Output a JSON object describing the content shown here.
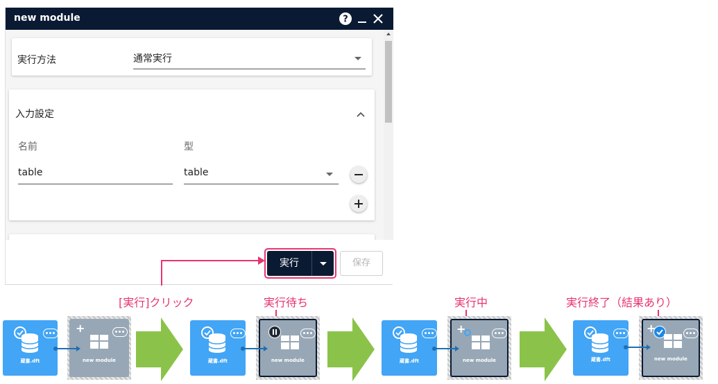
{
  "dialog": {
    "title": "new module",
    "exec_method_label": "実行方法",
    "exec_method_value": "通常実行",
    "input_section_title": "入力設定",
    "col_name_label": "名前",
    "col_type_label": "型",
    "row_name_value": "table",
    "row_type_value": "table",
    "run_button_label": "実行",
    "save_button_label": "保存"
  },
  "annotations": {
    "click_run": "[実行]クリック",
    "waiting": "実行待ち",
    "running": "実行中",
    "finished": "実行終了（結果あり）"
  },
  "flow": {
    "source_node_caption": "蔵書.dft",
    "module_node_caption": "new module"
  },
  "colors": {
    "titlebar": "#0b1a33",
    "accent_pink": "#e8336e",
    "node_blue": "#42a5f5",
    "node_gray": "#97a7b6",
    "arrow_green": "#8bc34a"
  }
}
